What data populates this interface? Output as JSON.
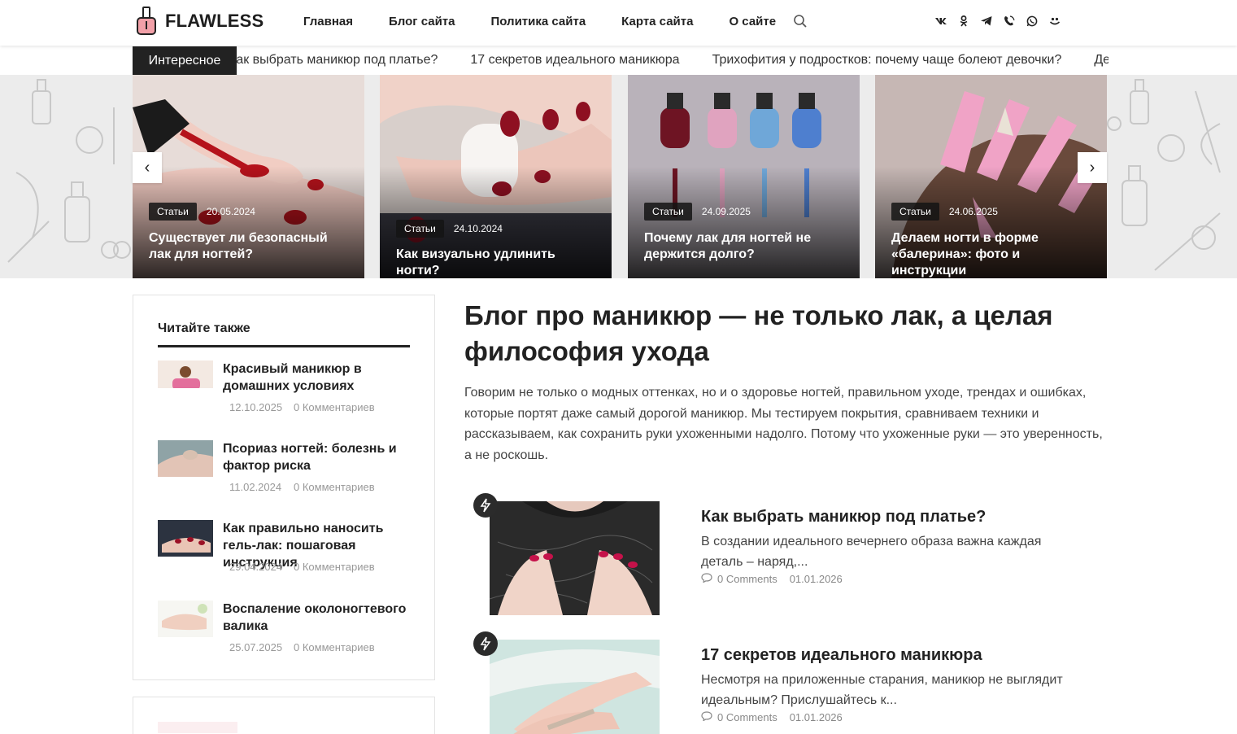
{
  "brand": {
    "name": "FLAWLESS"
  },
  "nav": [
    "Главная",
    "Блог сайта",
    "Политика сайта",
    "Карта сайта",
    "О сайте"
  ],
  "socials": [
    "vk-icon",
    "odnoklassniki-icon",
    "telegram-icon",
    "viber-icon",
    "whatsapp-icon",
    "moimir-icon"
  ],
  "ticker": {
    "label": "Интересное",
    "items": [
      "Как выбрать маникюр под платье?",
      "17 секретов идеального маникюра",
      "Трихофития у подростков: почему чаще болеют девочки?",
      "Дезинфекция маникюрных инструментов"
    ]
  },
  "slider": {
    "slides": [
      {
        "category": "Статьи",
        "date": "20.05.2024",
        "title": "Существует ли безопасный лак для ногтей?"
      },
      {
        "category": "Статьи",
        "date": "24.10.2024",
        "title": "Как визуально удлинить ногти?"
      },
      {
        "category": "Статьи",
        "date": "24.09.2025",
        "title": "Почему лак для ногтей не держится долго?"
      },
      {
        "category": "Статьи",
        "date": "24.06.2025",
        "title": "Делаем ногти в форме «балерина»: фото и инструкции"
      }
    ],
    "prev": "‹",
    "next": "›"
  },
  "sidebar": {
    "title": "Читайте также",
    "items": [
      {
        "title": "Красивый маникюр в домашних условиях",
        "date": "12.10.2025",
        "comments": "0 Комментариев"
      },
      {
        "title": "Псориаз ногтей: болезнь и фактор риска",
        "date": "11.02.2024",
        "comments": "0 Комментариев"
      },
      {
        "title": "Как правильно наносить гель-лак: пошаговая инструкция",
        "date": "29.04.2024",
        "comments": "0 Комментариев"
      },
      {
        "title": "Воспаление околоногтевого валика",
        "date": "25.07.2025",
        "comments": "0 Комментариев"
      }
    ]
  },
  "main": {
    "title": "Блог про маникюр — не только лак, а целая философия ухода",
    "intro": "Говорим не только о модных оттенках, но и о здоровье ногтей, правильном уходе, трендах и ошибках, которые портят даже самый дорогой маникюр. Мы тестируем покрытия, сравниваем техники и рассказываем, как сохранить руки ухоженными надолго. Потому что ухоженные руки — это уверенность, а не роскошь.",
    "posts": [
      {
        "title": "Как выбрать маникюр под платье?",
        "excerpt": "В создании идеального вечернего образа важна каждая деталь – наряд,...",
        "comments": "0 Comments",
        "date": "01.01.2026"
      },
      {
        "title": "17 секретов идеального маникюра",
        "excerpt": "Несмотря на приложенные старания, маникюр не выглядит идеальным? Прислушайтесь к...",
        "comments": "0 Comments",
        "date": "01.01.2026"
      }
    ]
  },
  "colors": {
    "accent": "#222222",
    "nail_red": "#b0101c",
    "logo_pink": "#f2a0a8"
  }
}
